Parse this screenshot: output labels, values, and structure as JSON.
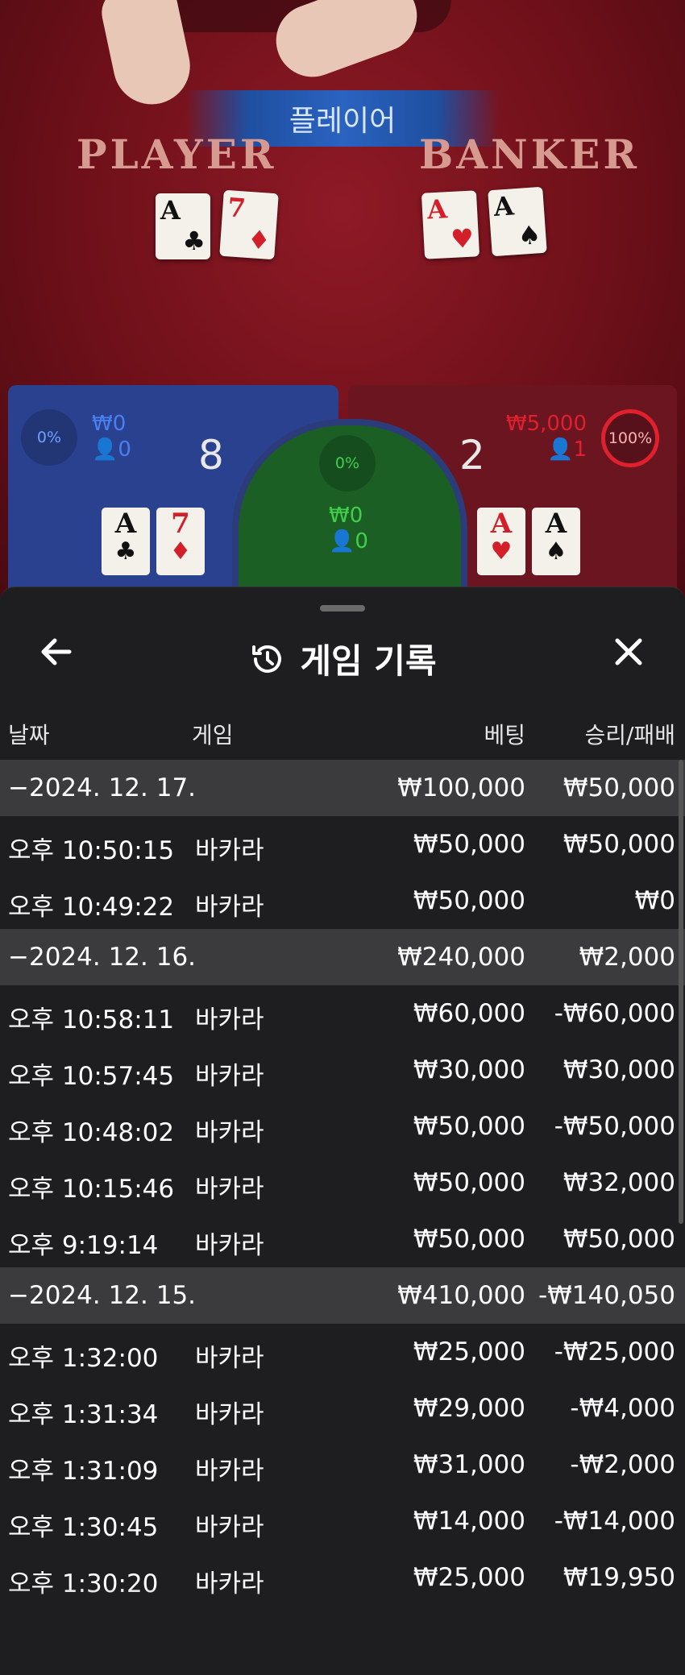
{
  "table": {
    "banner": "플레이어",
    "player_label": "PLAYER",
    "banker_label": "BANKER",
    "player_cards": [
      {
        "rank": "A",
        "suit": "♣",
        "color": "black"
      },
      {
        "rank": "7",
        "suit": "♦",
        "color": "red"
      }
    ],
    "banker_cards": [
      {
        "rank": "A",
        "suit": "♥",
        "color": "red"
      },
      {
        "rank": "A",
        "suit": "♠",
        "color": "black"
      }
    ]
  },
  "zones": {
    "player": {
      "pct": "0%",
      "amount": "₩0",
      "players": "0",
      "score": "8"
    },
    "tie": {
      "pct": "0%",
      "amount": "₩0",
      "players": "0"
    },
    "banker": {
      "pct": "100%",
      "amount": "₩5,000",
      "players": "1",
      "score": "2"
    }
  },
  "history": {
    "title": "게임 기록",
    "columns": {
      "date": "날짜",
      "game": "게임",
      "bet": "베팅",
      "result": "승리/패배"
    },
    "rows": [
      {
        "type": "date",
        "c1": "−2024. 12. 17.",
        "c2": "",
        "c3": "₩100,000",
        "c4": "₩50,000"
      },
      {
        "type": "game",
        "c1": "오후 10:50:15",
        "c2": "바카라",
        "c3": "₩50,000",
        "c4": "₩50,000"
      },
      {
        "type": "game",
        "c1": "오후 10:49:22",
        "c2": "바카라",
        "c3": "₩50,000",
        "c4": "₩0"
      },
      {
        "type": "date",
        "c1": "−2024. 12. 16.",
        "c2": "",
        "c3": "₩240,000",
        "c4": "₩2,000"
      },
      {
        "type": "game",
        "c1": "오후 10:58:11",
        "c2": "바카라",
        "c3": "₩60,000",
        "c4": "-₩60,000"
      },
      {
        "type": "game",
        "c1": "오후 10:57:45",
        "c2": "바카라",
        "c3": "₩30,000",
        "c4": "₩30,000"
      },
      {
        "type": "game",
        "c1": "오후 10:48:02",
        "c2": "바카라",
        "c3": "₩50,000",
        "c4": "-₩50,000"
      },
      {
        "type": "game",
        "c1": "오후 10:15:46",
        "c2": "바카라",
        "c3": "₩50,000",
        "c4": "₩32,000"
      },
      {
        "type": "game",
        "c1": "오후 9:19:14",
        "c2": "바카라",
        "c3": "₩50,000",
        "c4": "₩50,000"
      },
      {
        "type": "date",
        "c1": "−2024. 12. 15.",
        "c2": "",
        "c3": "₩410,000",
        "c4": "-₩140,050"
      },
      {
        "type": "game",
        "c1": "오후 1:32:00",
        "c2": "바카라",
        "c3": "₩25,000",
        "c4": "-₩25,000"
      },
      {
        "type": "game",
        "c1": "오후 1:31:34",
        "c2": "바카라",
        "c3": "₩29,000",
        "c4": "-₩4,000"
      },
      {
        "type": "game",
        "c1": "오후 1:31:09",
        "c2": "바카라",
        "c3": "₩31,000",
        "c4": "-₩2,000"
      },
      {
        "type": "game",
        "c1": "오후 1:30:45",
        "c2": "바카라",
        "c3": "₩14,000",
        "c4": "-₩14,000"
      },
      {
        "type": "game",
        "c1": "오후 1:30:20",
        "c2": "바카라",
        "c3": "₩25,000",
        "c4": "₩19,950"
      }
    ]
  },
  "colors": {
    "player_blue": "#4a7ff0",
    "tie_green": "#3fcf4a",
    "banker_red": "#e0202c"
  }
}
